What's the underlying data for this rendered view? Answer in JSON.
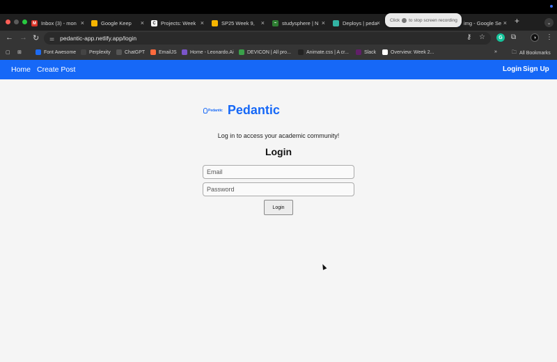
{
  "browser": {
    "tabs": [
      {
        "label": "Inbox (3) - mon",
        "icon": "gmail-icon",
        "color": "#d93025",
        "glyph": "M"
      },
      {
        "label": "Google Keep",
        "icon": "keep-icon",
        "color": "#f6b400",
        "glyph": ""
      },
      {
        "label": "Projects: Week",
        "icon": "codepath-icon",
        "color": "#ffffff",
        "glyph": "C"
      },
      {
        "label": "SP25 Week 9, ",
        "icon": "slides-icon",
        "color": "#f4b400",
        "glyph": ""
      },
      {
        "label": "studysphere | N",
        "icon": "leaf-icon",
        "color": "#2e7d32",
        "glyph": "~"
      },
      {
        "label": "Deploys | peda",
        "icon": "netlify-icon",
        "color": "#32b3a3",
        "glyph": ""
      },
      {
        "label": "img - Google Se",
        "icon": "google-icon",
        "color": "#4285f4",
        "glyph": "G"
      }
    ],
    "recording_tip": "Click",
    "recording_tip_rest": "to stop screen recording",
    "url": "pedantic-app.netlify.app/login",
    "bookmarks": [
      {
        "label": "Font Awesome",
        "icon": "flag-icon",
        "color": "#1d6bf3"
      },
      {
        "label": "Perplexity",
        "icon": "perplexity-icon",
        "color": "#444"
      },
      {
        "label": "ChatGPT",
        "icon": "chatgpt-icon",
        "color": "#555"
      },
      {
        "label": "EmailJS",
        "icon": "emailjs-icon",
        "color": "#ff6a3d"
      },
      {
        "label": "Home - Leonardo.Ai",
        "icon": "leonardo-icon",
        "color": "#7a55c9"
      },
      {
        "label": "DEVICON | All pro...",
        "icon": "devicon-icon",
        "color": "#3aa14a"
      },
      {
        "label": "Animate.css | A cr...",
        "icon": "animate-icon",
        "color": "#222"
      },
      {
        "label": "Slack",
        "icon": "slack-icon",
        "color": "#611f69"
      },
      {
        "label": "Overview: Week 2...",
        "icon": "codepath-icon",
        "color": "#ffffff"
      }
    ],
    "all_bookmarks": "All Bookmarks"
  },
  "nav": {
    "home": "Home",
    "create_post": "Create Post",
    "login": "Login",
    "signup": "Sign Up"
  },
  "brand": {
    "mini": "Pedantic",
    "name": "Pedantic"
  },
  "page": {
    "subtitle": "Log in to access your academic community!",
    "heading": "Login",
    "email_placeholder": "Email",
    "password_placeholder": "Password",
    "submit_label": "Login"
  },
  "colors": {
    "accent": "#1668f7"
  }
}
